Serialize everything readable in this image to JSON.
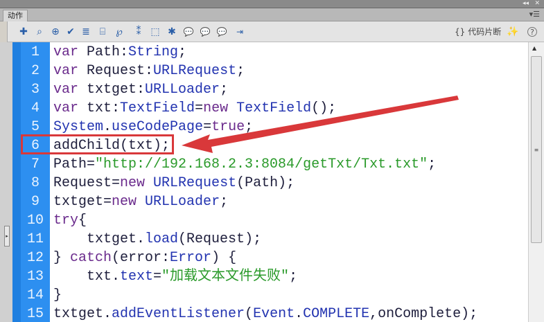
{
  "panel": {
    "tab": "动作",
    "collapse": "◂◂",
    "close": "✕",
    "menu": "▾☰"
  },
  "toolbar": {
    "icons": [
      "add-icon",
      "find-icon",
      "target-icon",
      "check-syntax-icon",
      "auto-format-icon",
      "code-hint-icon",
      "debug-options-icon",
      "collapse-braces-icon",
      "collapse-selection-icon",
      "expand-all-icon",
      "block-comment-icon",
      "line-comment-icon",
      "remove-comment-icon",
      "script-assist-icon"
    ],
    "glyphs": [
      "✚",
      "⌕",
      "⊕",
      "✔",
      "≣",
      "⌸",
      "℘",
      "⁑",
      "⬚",
      "✱",
      "💬",
      "💬",
      "💬",
      "⇥"
    ],
    "snippets": "代码片断",
    "wand": "✨",
    "help": "?"
  },
  "code": {
    "lines": [
      {
        "n": "1",
        "t": [
          [
            "var",
            "kw"
          ],
          " Path:",
          [
            "String",
            "ty"
          ],
          ";"
        ]
      },
      {
        "n": "2",
        "t": [
          [
            "var",
            "kw"
          ],
          " Request:",
          [
            "URLRequest",
            "ty"
          ],
          ";"
        ]
      },
      {
        "n": "3",
        "t": [
          [
            "var",
            "kw"
          ],
          " txtget:",
          [
            "URLLoader",
            "ty"
          ],
          ";"
        ]
      },
      {
        "n": "4",
        "t": [
          [
            "var",
            "kw"
          ],
          " txt:",
          [
            "TextField",
            "ty"
          ],
          "=",
          [
            "new",
            "kw"
          ],
          " ",
          [
            "TextField",
            "ty"
          ],
          "();"
        ]
      },
      {
        "n": "5",
        "t": [
          [
            "System",
            "ty"
          ],
          ".",
          [
            "useCodePage",
            "ty"
          ],
          "=",
          [
            "true",
            "kw"
          ],
          ";"
        ]
      },
      {
        "n": "6",
        "t": [
          "addChild(txt);"
        ]
      },
      {
        "n": "7",
        "t": [
          "Path=",
          [
            "\"http://192.168.2.3:8084/getTxt/Txt.txt\"",
            "st"
          ],
          ";"
        ]
      },
      {
        "n": "8",
        "t": [
          "Request=",
          [
            "new",
            "kw"
          ],
          " ",
          [
            "URLRequest",
            "ty"
          ],
          "(Path);"
        ]
      },
      {
        "n": "9",
        "t": [
          "txtget=",
          [
            "new",
            "kw"
          ],
          " ",
          [
            "URLLoader",
            "ty"
          ],
          ";"
        ]
      },
      {
        "n": "10",
        "t": [
          [
            "try",
            "kw"
          ],
          "{"
        ]
      },
      {
        "n": "11",
        "t": [
          "    txtget.",
          [
            "load",
            "ty"
          ],
          "(Request);"
        ]
      },
      {
        "n": "12",
        "t": [
          "} ",
          [
            "catch",
            "kw"
          ],
          "(error:",
          [
            "Error",
            "ty"
          ],
          ") {"
        ]
      },
      {
        "n": "13",
        "t": [
          "    txt.",
          [
            "text",
            "ty"
          ],
          "=",
          [
            "\"加载文本文件失败\"",
            "st"
          ],
          ";"
        ]
      },
      {
        "n": "14",
        "t": [
          "}"
        ]
      },
      {
        "n": "15",
        "t": [
          "txtget.",
          [
            "addEventListener",
            "ty"
          ],
          "(",
          [
            "Event",
            "ty"
          ],
          ".",
          [
            "COMPLETE",
            "ty"
          ],
          ",onComplete);"
        ]
      }
    ]
  },
  "annotation": {
    "color": "#d9383a",
    "highlighted_line": "6"
  }
}
